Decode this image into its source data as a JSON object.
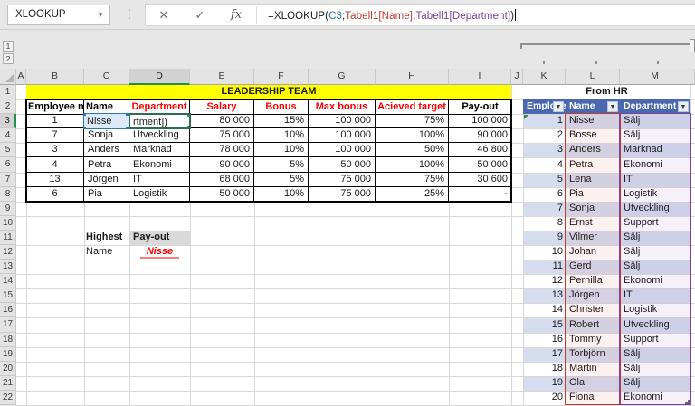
{
  "formula_bar": {
    "name_box_value": "XLOOKUP",
    "dropdown_icon": "chevron-down",
    "cancel_icon": "✕",
    "enter_icon": "✓",
    "insert_function_label": "fx",
    "separator_icon": "⋮",
    "formula_parts": [
      {
        "text": "=XLOOKUP(",
        "color": "#1a1a1a"
      },
      {
        "text": "C3",
        "color": "#2E75B6"
      },
      {
        "text": ";",
        "color": "#1a1a1a"
      },
      {
        "text": "Tabell1[Name]",
        "color": "#C23A34"
      },
      {
        "text": ";",
        "color": "#1a1a1a"
      },
      {
        "text": "Tabell1[Department]",
        "color": "#7B3F9E"
      },
      {
        "text": ")",
        "color": "#1a1a1a"
      }
    ]
  },
  "outline": {
    "levels": [
      "1",
      "2"
    ]
  },
  "grid": {
    "column_letters": [
      "A",
      "B",
      "C",
      "D",
      "E",
      "F",
      "G",
      "H",
      "I",
      "J",
      "K",
      "L",
      "M"
    ],
    "visible_rows": 22,
    "active_column": "D",
    "active_row": 3
  },
  "leadership_table": {
    "title": "LEADERSHIP TEAM",
    "headers": [
      {
        "label": "Employee nr",
        "color": "#000000",
        "align": "left"
      },
      {
        "label": "Name",
        "color": "#000000",
        "align": "left"
      },
      {
        "label": "Department",
        "color": "#FF0000",
        "align": "center"
      },
      {
        "label": "Salary",
        "color": "#FF0000",
        "align": "center"
      },
      {
        "label": "Bonus",
        "color": "#FF0000",
        "align": "center"
      },
      {
        "label": "Max bonus",
        "color": "#FF0000",
        "align": "center"
      },
      {
        "label": "Acieved target",
        "color": "#FF0000",
        "align": "center"
      },
      {
        "label": "Pay-out",
        "color": "#000000",
        "align": "center"
      }
    ],
    "rows": [
      [
        "1",
        "Nisse",
        "",
        "80 000",
        "15%",
        "100 000",
        "75%",
        "100 000"
      ],
      [
        "7",
        "Sonja",
        "Utveckling",
        "75 000",
        "10%",
        "100 000",
        "100%",
        "90 000"
      ],
      [
        "3",
        "Anders",
        "Marknad",
        "78 000",
        "10%",
        "100 000",
        "50%",
        "46 800"
      ],
      [
        "4",
        "Petra",
        "Ekonomi",
        "90 000",
        "5%",
        "50 000",
        "100%",
        "50 000"
      ],
      [
        "13",
        "Jörgen",
        "IT",
        "68 000",
        "5%",
        "75 000",
        "75%",
        "30 600"
      ],
      [
        "6",
        "Pia",
        "Logistik",
        "50 000",
        "10%",
        "75 000",
        "25%",
        "-"
      ]
    ]
  },
  "edit_state": {
    "reference_cell_value": "Nisse",
    "editing_cell_text": "rtment])"
  },
  "summary": {
    "highest_label": "Highest",
    "payout_label": "Pay-out",
    "name_label": "Name",
    "name_value": "Nisse"
  },
  "hr_table": {
    "title": "From HR",
    "headers": [
      "Employe",
      "Name",
      "Department"
    ],
    "rows": [
      [
        "1",
        "Nisse",
        "Sälj"
      ],
      [
        "2",
        "Bosse",
        "Sälj"
      ],
      [
        "3",
        "Anders",
        "Marknad"
      ],
      [
        "4",
        "Petra",
        "Ekonomi"
      ],
      [
        "5",
        "Lena",
        "IT"
      ],
      [
        "6",
        "Pia",
        "Logistik"
      ],
      [
        "7",
        "Sonja",
        "Utveckling"
      ],
      [
        "8",
        "Ernst",
        "Support"
      ],
      [
        "9",
        "Vilmer",
        "Sälj"
      ],
      [
        "10",
        "Johan",
        "Sälj"
      ],
      [
        "11",
        "Gerd",
        "Sälj"
      ],
      [
        "12",
        "Pernilla",
        "Ekonomi"
      ],
      [
        "13",
        "Jörgen",
        "IT"
      ],
      [
        "14",
        "Christer",
        "Logistik"
      ],
      [
        "15",
        "Robert",
        "Utveckling"
      ],
      [
        "16",
        "Tommy",
        "Support"
      ],
      [
        "17",
        "Torbjörn",
        "Sälj"
      ],
      [
        "18",
        "Martin",
        "Sälj"
      ],
      [
        "19",
        "Ola",
        "Sälj"
      ],
      [
        "20",
        "Fiona",
        "Ekonomi"
      ]
    ]
  },
  "colors": {
    "ref_blue": "#2E75B6",
    "ref_red": "#C23A34",
    "ref_purple": "#7B3F9E",
    "edit_green": "#2F6B4F",
    "banner_yellow": "#FFFF00",
    "header_red": "#FF0000",
    "hr_header_bg": "#4A68AE",
    "band_blue": "#D4DCEE",
    "gray_fill": "#D9D9D9",
    "active_green": "#1E8F4E"
  }
}
